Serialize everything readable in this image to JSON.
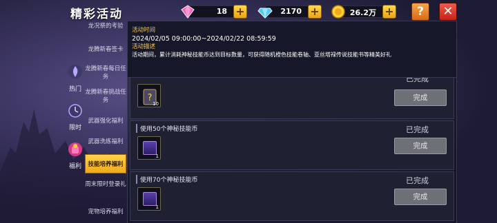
{
  "header": {
    "title": "精彩活动",
    "pink_gems": "18",
    "blue_gems": "2170",
    "coins": "26.2万",
    "help_label": "?",
    "close_label": "✕"
  },
  "categories": [
    {
      "label": "热门",
      "icon": "hot-icon"
    },
    {
      "label": "限时",
      "icon": "timer-icon"
    },
    {
      "label": "福利",
      "icon": "gift-bag-icon"
    }
  ],
  "subtabs": [
    {
      "label": "龙况祭的考验"
    },
    {
      "label": "龙腾新春签卡"
    },
    {
      "label": "龙腾新春每日任务"
    },
    {
      "label": "龙腾新春挑战任务"
    },
    {
      "label": "武器强化福利"
    },
    {
      "label": "武器洗练福利"
    },
    {
      "label": "技能培养福利"
    },
    {
      "label": "周末限时登录礼"
    },
    {
      "label": "宠物培养福利"
    }
  ],
  "activity": {
    "time_label": "活动时间",
    "time_value": "2024/02/05 09:00:00~2024/02/22 08:59:59",
    "desc_label": "活动描述",
    "desc_value": "活动期间，累计消耗神秘技能币达到目标数量，可获得随机橙色技能卷轴、亚丝塔禄传说技能书等精美好礼"
  },
  "tasks": [
    {
      "name": "",
      "qty": "10",
      "status": "已完成",
      "button": "完成"
    },
    {
      "name": "使用50个神秘技能币",
      "qty": "1",
      "status": "已完成",
      "button": "完成"
    },
    {
      "name": "使用70个神秘技能币",
      "qty": "1",
      "status": "已完成",
      "button": "完成"
    }
  ],
  "colors": {
    "accent_gold": "#f3c84a",
    "active_tab": "#ffd34a",
    "close_red": "#e8402e",
    "help_orange": "#f09a3a"
  }
}
